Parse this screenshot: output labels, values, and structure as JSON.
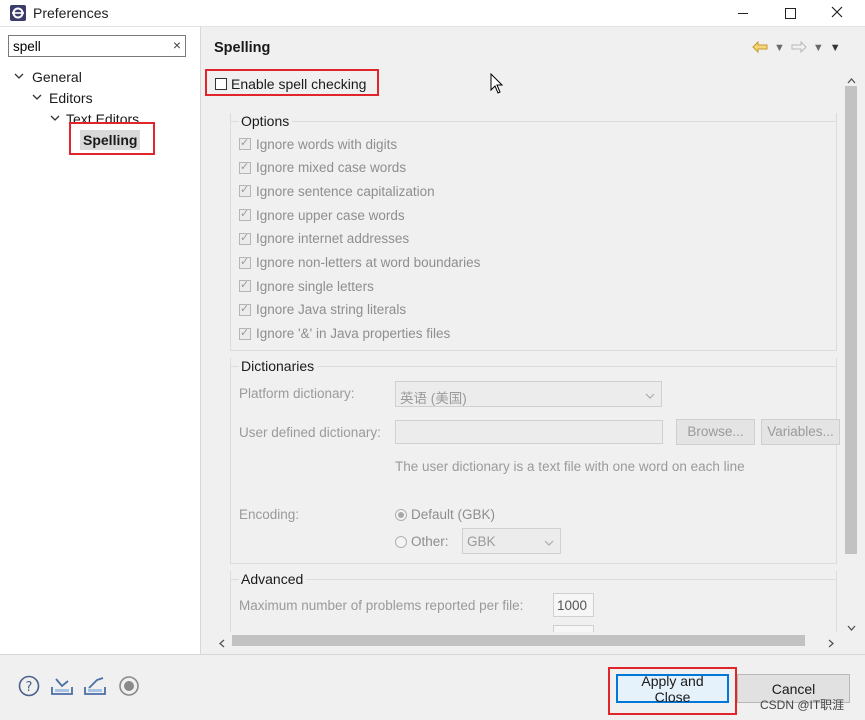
{
  "window": {
    "title": "Preferences",
    "minimize_icon": "minimize-icon",
    "maximize_icon": "maximize-icon",
    "close_icon": "close-icon"
  },
  "filter": {
    "value": "spell",
    "clear": "×"
  },
  "tree": {
    "general": "General",
    "editors": "Editors",
    "text_editors": "Text Editors",
    "spelling": "Spelling"
  },
  "page": {
    "title": "Spelling",
    "enable_label": "Enable spell checking",
    "enable_checked": false
  },
  "options": {
    "title": "Options",
    "items": [
      {
        "label": "Ignore words with digits",
        "checked": true
      },
      {
        "label": "Ignore mixed case words",
        "checked": true
      },
      {
        "label": "Ignore sentence capitalization",
        "checked": true
      },
      {
        "label": "Ignore upper case words",
        "checked": true
      },
      {
        "label": "Ignore internet addresses",
        "checked": true
      },
      {
        "label": "Ignore non-letters at word boundaries",
        "checked": true
      },
      {
        "label": "Ignore single letters",
        "checked": true
      },
      {
        "label": "Ignore Java string literals",
        "checked": true
      },
      {
        "label": "Ignore '&' in Java properties files",
        "checked": true
      }
    ]
  },
  "dictionaries": {
    "title": "Dictionaries",
    "platform_label": "Platform dictionary:",
    "platform_value": "英语 (美国)",
    "user_label": "User defined dictionary:",
    "user_value": "",
    "browse": "Browse...",
    "variables": "Variables...",
    "hint": "The user dictionary is a text file with one word on each line",
    "encoding_label": "Encoding:",
    "default_option": "Default (GBK)",
    "other_option": "Other:",
    "other_value": "GBK"
  },
  "advanced": {
    "title": "Advanced",
    "max_problems_label": "Maximum number of problems reported per file:",
    "max_problems_value": "1000"
  },
  "buttons": {
    "apply_close": "Apply and Close",
    "cancel": "Cancel"
  },
  "watermark": "CSDN @IT职涯",
  "colors": {
    "highlight": "#e0262b",
    "focus": "#0078d7"
  }
}
